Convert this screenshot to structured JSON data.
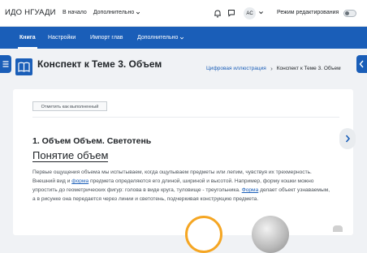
{
  "header": {
    "brand": "ИДО НГУАДИ",
    "nav": {
      "home": "В начало",
      "more": "Дополнительно"
    },
    "avatar_initials": "AC",
    "edit_mode_label": "Режим редактирования"
  },
  "course_nav": {
    "tabs": [
      {
        "label": "Книга"
      },
      {
        "label": "Настройки"
      },
      {
        "label": "Импорт глав"
      },
      {
        "label": "Дополнительно"
      }
    ]
  },
  "page": {
    "title": "Конспект к Теме 3. Объем",
    "breadcrumb": {
      "parent": "Цифровая иллюстрация",
      "current": "Конспект к Теме 3. Объем"
    }
  },
  "content": {
    "mark_done_label": "Отметить как выполненный",
    "heading": "1. Объем Объем. Светотень",
    "subheading": "Понятие объем",
    "paragraph": {
      "p1": "Первые ощущения объема мы испытываем, когда ощупываем предметы или лепим, чувствуя их трехмерность. Внешний вид и ",
      "link1": "форма",
      "p2": " предмета определяются его длиной, шириной и высотой. Например, форму кошки можно упростить до геометрических фигур: голова в виде круга, туловище - треугольника. ",
      "link2": "Форма",
      "p3": " делает объект узнаваемым, а в рисунке она передается через линии и светотень, подчеркивая конструкцию предмета."
    }
  },
  "colors": {
    "accent": "#1a5eb8",
    "background": "#f0f2f5",
    "card": "#ffffff"
  },
  "icons": {
    "sidebar_toggle": "hamburger-icon",
    "drawer_toggle": "chevron-left-icon",
    "book": "book-icon",
    "notifications": "bell-icon",
    "messages": "chat-icon",
    "next_page": "chevron-right-icon"
  }
}
